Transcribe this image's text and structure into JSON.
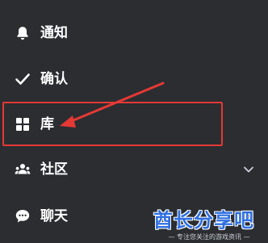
{
  "menu": {
    "items": [
      {
        "label": "通知",
        "icon": "bell-icon"
      },
      {
        "label": "确认",
        "icon": "checkmark-icon"
      },
      {
        "label": "库",
        "icon": "grid-icon"
      },
      {
        "label": "社区",
        "icon": "community-icon",
        "expandable": true
      },
      {
        "label": "聊天",
        "icon": "chat-bubble-icon"
      }
    ]
  },
  "annotation": {
    "color": "#e53935",
    "highlighted_item": "库"
  },
  "watermark": {
    "main": "酋长分享吧",
    "tagline": "— 专注您关注的游戏资讯 —"
  },
  "colors": {
    "background": "#2b2d31",
    "text": "#ffffff",
    "watermark": "#2f6fe0"
  }
}
